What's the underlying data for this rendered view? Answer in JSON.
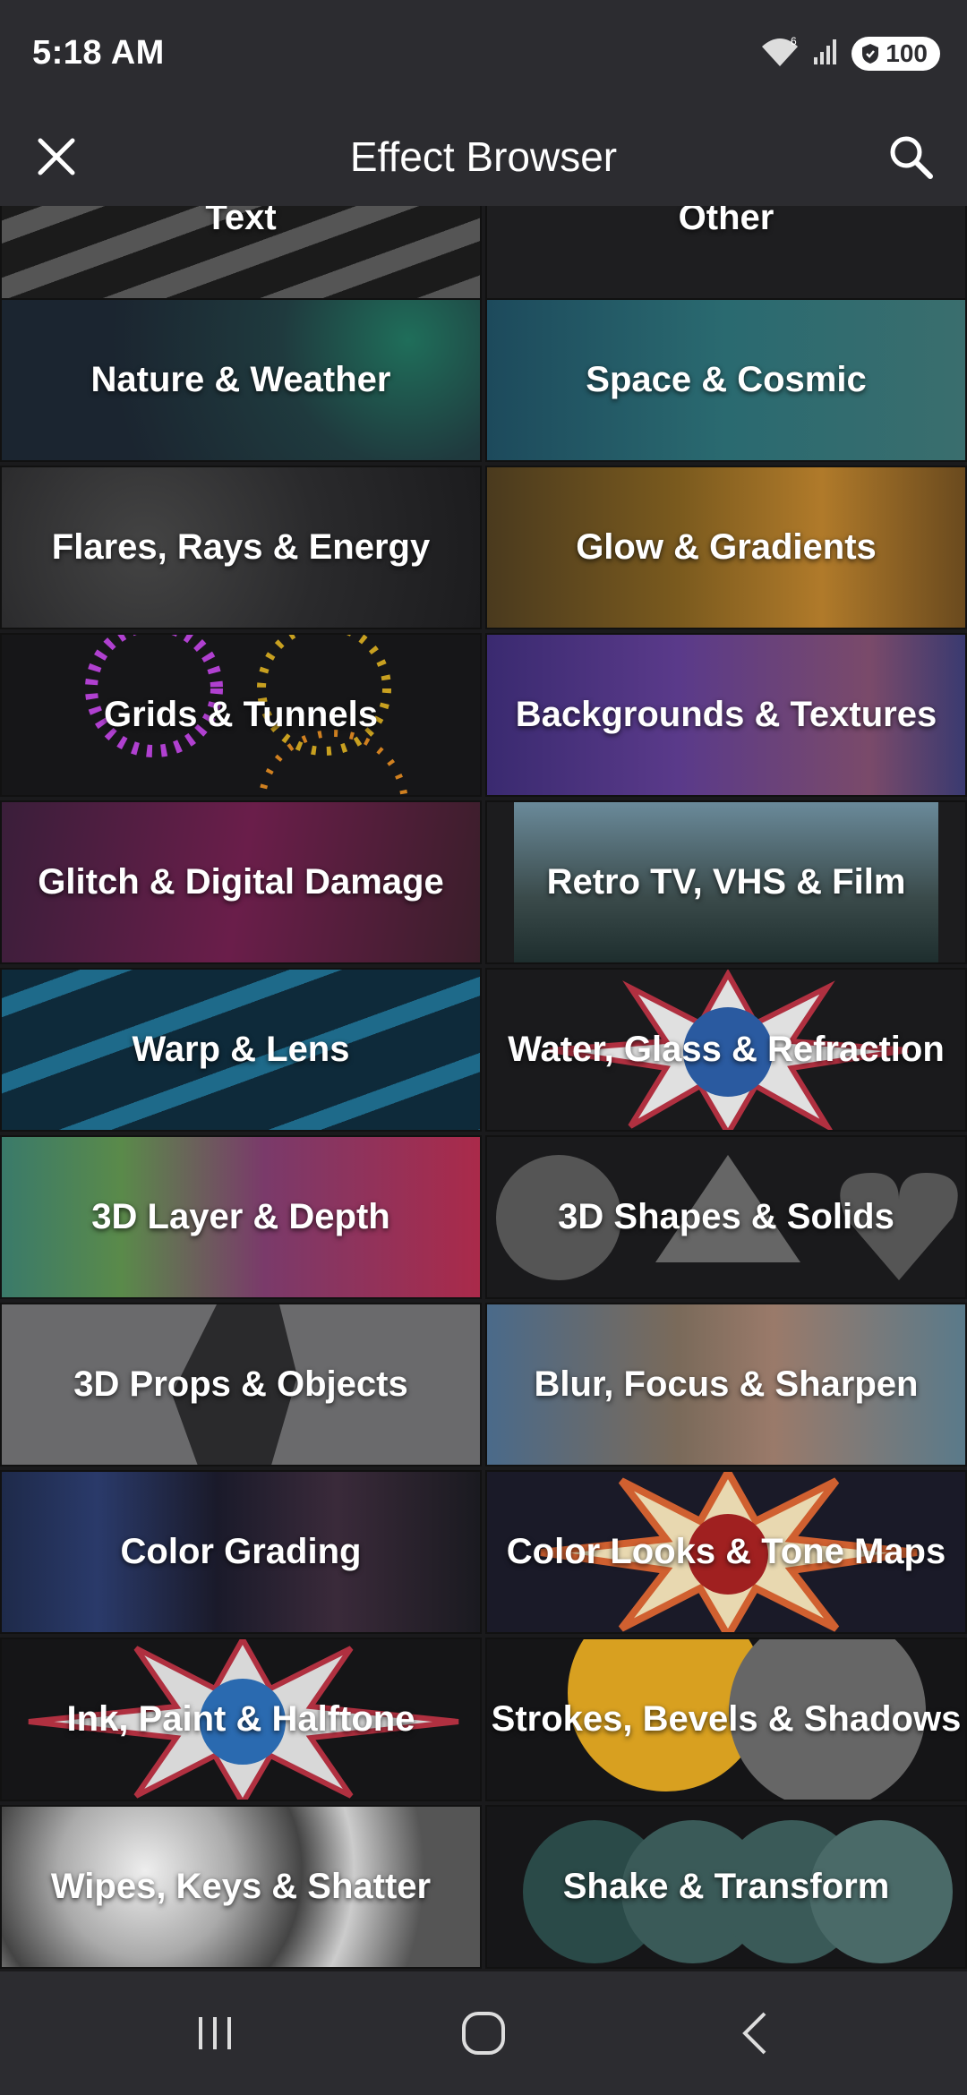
{
  "status": {
    "time": "5:18 AM",
    "battery": "100",
    "wifi_icon": "wifi-icon",
    "signal_icon": "signal-icon"
  },
  "header": {
    "title": "Effect Browser",
    "close_icon": "close-icon",
    "search_icon": "search-icon"
  },
  "tiles": [
    {
      "label": "Text"
    },
    {
      "label": "Other"
    },
    {
      "label": "Nature & Weather"
    },
    {
      "label": "Space & Cosmic"
    },
    {
      "label": "Flares, Rays & Energy"
    },
    {
      "label": "Glow & Gradients"
    },
    {
      "label": "Grids & Tunnels"
    },
    {
      "label": "Backgrounds & Textures"
    },
    {
      "label": "Glitch & Digital Damage"
    },
    {
      "label": "Retro TV, VHS & Film"
    },
    {
      "label": "Warp & Lens"
    },
    {
      "label": "Water, Glass & Refraction"
    },
    {
      "label": "3D Layer & Depth"
    },
    {
      "label": "3D Shapes & Solids"
    },
    {
      "label": "3D Props & Objects"
    },
    {
      "label": "Blur, Focus & Sharpen"
    },
    {
      "label": "Color Grading"
    },
    {
      "label": "Color Looks & Tone Maps"
    },
    {
      "label": "Ink, Paint & Halftone"
    },
    {
      "label": "Strokes, Bevels & Shadows"
    },
    {
      "label": "Wipes, Keys & Shatter"
    },
    {
      "label": "Shake & Transform"
    }
  ],
  "nav": {
    "recents_icon": "recents-icon",
    "home_icon": "home-icon",
    "back_icon": "back-icon"
  }
}
